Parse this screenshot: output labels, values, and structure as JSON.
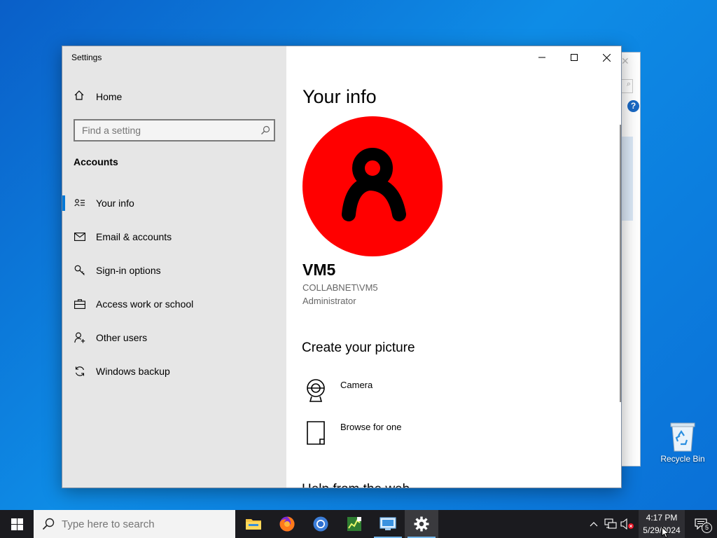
{
  "window": {
    "title": "Settings"
  },
  "sidebar": {
    "home_label": "Home",
    "search_placeholder": "Find a setting",
    "section_title": "Accounts",
    "items": [
      {
        "label": "Your info",
        "icon": "person-card-icon",
        "active": true
      },
      {
        "label": "Email & accounts",
        "icon": "mail-icon",
        "active": false
      },
      {
        "label": "Sign-in options",
        "icon": "key-icon",
        "active": false
      },
      {
        "label": "Access work or school",
        "icon": "briefcase-icon",
        "active": false
      },
      {
        "label": "Other users",
        "icon": "person-add-icon",
        "active": false
      },
      {
        "label": "Windows backup",
        "icon": "sync-icon",
        "active": false
      }
    ]
  },
  "main": {
    "page_title": "Your info",
    "user": {
      "name": "VM5",
      "domain_account": "COLLABNET\\VM5",
      "role": "Administrator",
      "avatar_color": "#ff0000"
    },
    "create_picture_heading": "Create your picture",
    "options": [
      {
        "label": "Camera",
        "icon": "webcam-icon"
      },
      {
        "label": "Browse for one",
        "icon": "file-icon"
      }
    ],
    "help_heading": "Help from the web"
  },
  "taskbar": {
    "search_placeholder": "Type here to search",
    "apps": [
      {
        "name": "file-explorer",
        "icon": "folder-icon"
      },
      {
        "name": "firefox",
        "icon": "firefox-icon"
      },
      {
        "name": "chrome",
        "icon": "chrome-icon"
      },
      {
        "name": "task-manager",
        "icon": "chart-icon"
      },
      {
        "name": "remote-desktop",
        "icon": "monitor-icon"
      },
      {
        "name": "settings",
        "icon": "gear-icon"
      }
    ],
    "clock_time": "4:17 PM",
    "clock_date": "5/29/2024",
    "notification_count": "5"
  },
  "desktop": {
    "recycle_bin_label": "Recycle Bin"
  },
  "colors": {
    "accent": "#0078d7",
    "sidebar_bg": "#e6e6e6",
    "taskbar_bg": "#1b1b1f"
  }
}
